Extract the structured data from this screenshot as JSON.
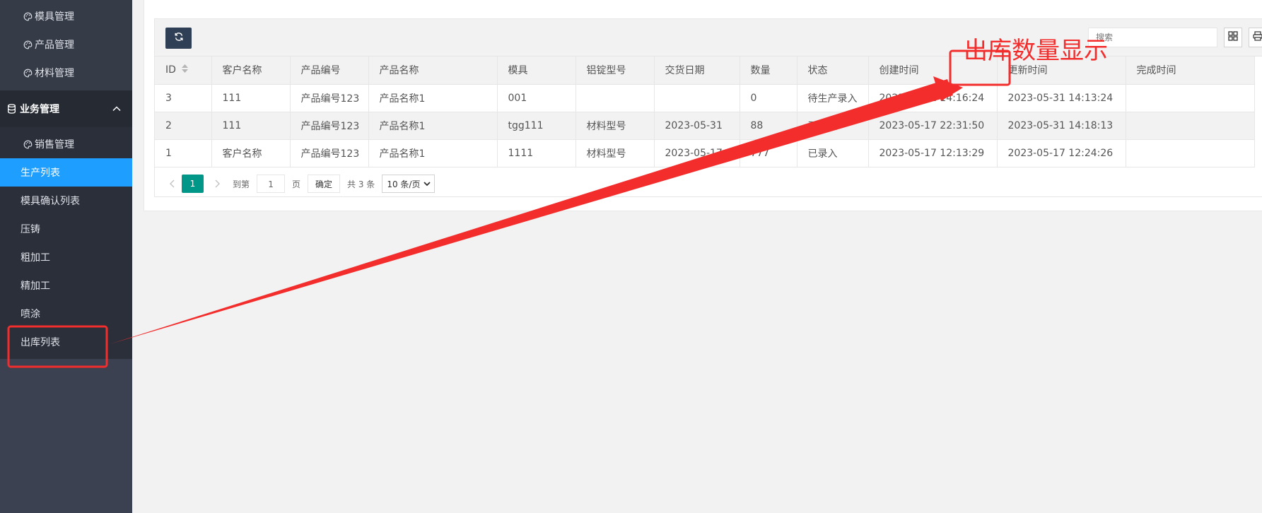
{
  "sidebar": {
    "top_items": [
      {
        "label": "模具管理",
        "icon": "palette-icon"
      },
      {
        "label": "产品管理",
        "icon": "palette-icon"
      },
      {
        "label": "材料管理",
        "icon": "palette-icon"
      }
    ],
    "group": {
      "label": "业务管理",
      "icon": "database-icon",
      "expanded": true
    },
    "items": [
      {
        "label": "销售管理",
        "icon": "palette-icon"
      },
      {
        "label": "生产列表",
        "active": true
      },
      {
        "label": "模具确认列表"
      },
      {
        "label": "压铸"
      },
      {
        "label": "粗加工"
      },
      {
        "label": "精加工"
      },
      {
        "label": "喷涂"
      },
      {
        "label": "出库列表"
      }
    ]
  },
  "toolbar": {
    "search_placeholder": "搜索",
    "icons": [
      "refresh-icon",
      "columns-icon",
      "print-icon"
    ]
  },
  "table": {
    "columns": [
      "ID",
      "客户名称",
      "产品编号",
      "产品名称",
      "模具",
      "铝锭型号",
      "交货日期",
      "数量",
      "状态",
      "创建时间",
      "更新时间",
      "完成时间"
    ],
    "rows": [
      [
        "3",
        "111",
        "产品编号123",
        "产品名称1",
        "001",
        "",
        "",
        "0",
        "待生产录入",
        "2023-05-31 14:16:24",
        "2023-05-31 14:13:24",
        ""
      ],
      [
        "2",
        "111",
        "产品编号123",
        "产品名称1",
        "tgg111",
        "材料型号",
        "2023-05-31",
        "88",
        "已录入",
        "2023-05-17 22:31:50",
        "2023-05-31 14:18:13",
        ""
      ],
      [
        "1",
        "客户名称",
        "产品编号123",
        "产品名称1",
        "1111",
        "材料型号",
        "2023-05-17",
        "777",
        "已录入",
        "2023-05-17 12:13:29",
        "2023-05-17 12:24:26",
        ""
      ]
    ]
  },
  "pager": {
    "current_page": "1",
    "goto_label": "到第",
    "goto_value": "1",
    "page_unit": "页",
    "confirm_label": "确定",
    "total_label": "共 3 条",
    "page_size": "10 条/页"
  },
  "annotation": {
    "text": "出库数量显示",
    "color": "#f32c2c"
  }
}
